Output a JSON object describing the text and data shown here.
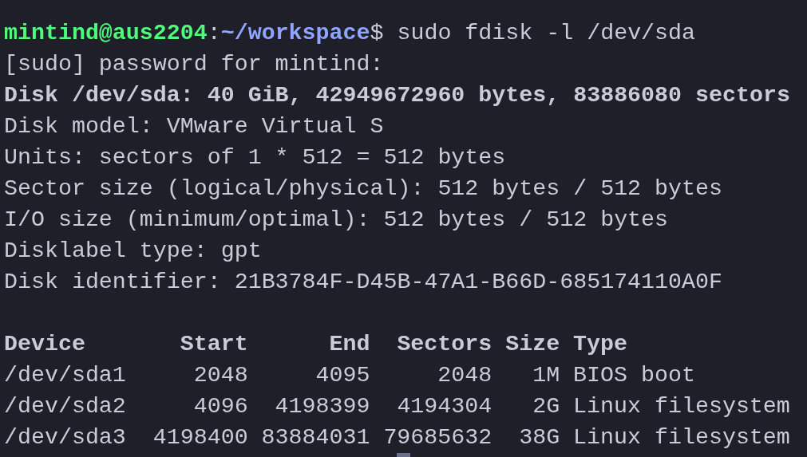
{
  "prompt": {
    "user_host": "mintind@aus2204",
    "separator": ":",
    "path": "~/workspace",
    "symbol": "$",
    "command": "sudo fdisk -l /dev/sda"
  },
  "lines": [
    {
      "text": "[sudo] password for mintind:",
      "bold": false
    },
    {
      "text": "Disk /dev/sda: 40 GiB, 42949672960 bytes, 83886080 sectors",
      "bold": true
    },
    {
      "text": "Disk model: VMware Virtual S",
      "bold": false
    },
    {
      "text": "Units: sectors of 1 * 512 = 512 bytes",
      "bold": false
    },
    {
      "text": "Sector size (logical/physical): 512 bytes / 512 bytes",
      "bold": false
    },
    {
      "text": "I/O size (minimum/optimal): 512 bytes / 512 bytes",
      "bold": false
    },
    {
      "text": "Disklabel type: gpt",
      "bold": false
    },
    {
      "text": "Disk identifier: 21B3784F-D45B-47A1-B66D-685174110A0F",
      "bold": false
    }
  ],
  "table": {
    "columns": [
      "Device",
      "Start",
      "End",
      "Sectors",
      "Size",
      "Type"
    ],
    "rows": [
      [
        "/dev/sda1",
        "2048",
        "4095",
        "2048",
        "1M",
        "BIOS boot"
      ],
      [
        "/dev/sda2",
        "4096",
        "4198399",
        "4194304",
        "2G",
        "Linux filesystem"
      ],
      [
        "/dev/sda3",
        "4198400",
        "83884031",
        "79685632",
        "38G",
        "Linux filesystem"
      ]
    ]
  }
}
